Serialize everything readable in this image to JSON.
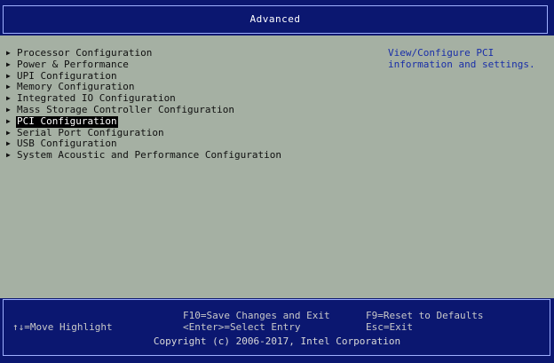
{
  "header": {
    "title": "Advanced"
  },
  "menu": {
    "items": [
      {
        "label": "Processor Configuration",
        "selected": false
      },
      {
        "label": "Power & Performance",
        "selected": false
      },
      {
        "label": "UPI Configuration",
        "selected": false
      },
      {
        "label": "Memory Configuration",
        "selected": false
      },
      {
        "label": "Integrated IO Configuration",
        "selected": false
      },
      {
        "label": "Mass Storage Controller Configuration",
        "selected": false
      },
      {
        "label": "PCI Configuration",
        "selected": true
      },
      {
        "label": "Serial Port Configuration",
        "selected": false
      },
      {
        "label": "USB Configuration",
        "selected": false
      },
      {
        "label": "System Acoustic and Performance Configuration",
        "selected": false
      }
    ]
  },
  "help": {
    "line1": "View/Configure PCI",
    "line2": "information and settings."
  },
  "status": {
    "save": "F10=Save Changes and Exit",
    "reset": "F9=Reset to Defaults",
    "move": "↑↓=Move Highlight",
    "select": "<Enter>=Select Entry",
    "esc": "Esc=Exit",
    "copyright": "Copyright (c) 2006-2017, Intel Corporation"
  },
  "colors": {
    "background": "#0b1770",
    "panel": "#a5b0a3",
    "help_text": "#1a2fa8",
    "selection_bg": "#000000",
    "selection_fg": "#ffffff"
  }
}
